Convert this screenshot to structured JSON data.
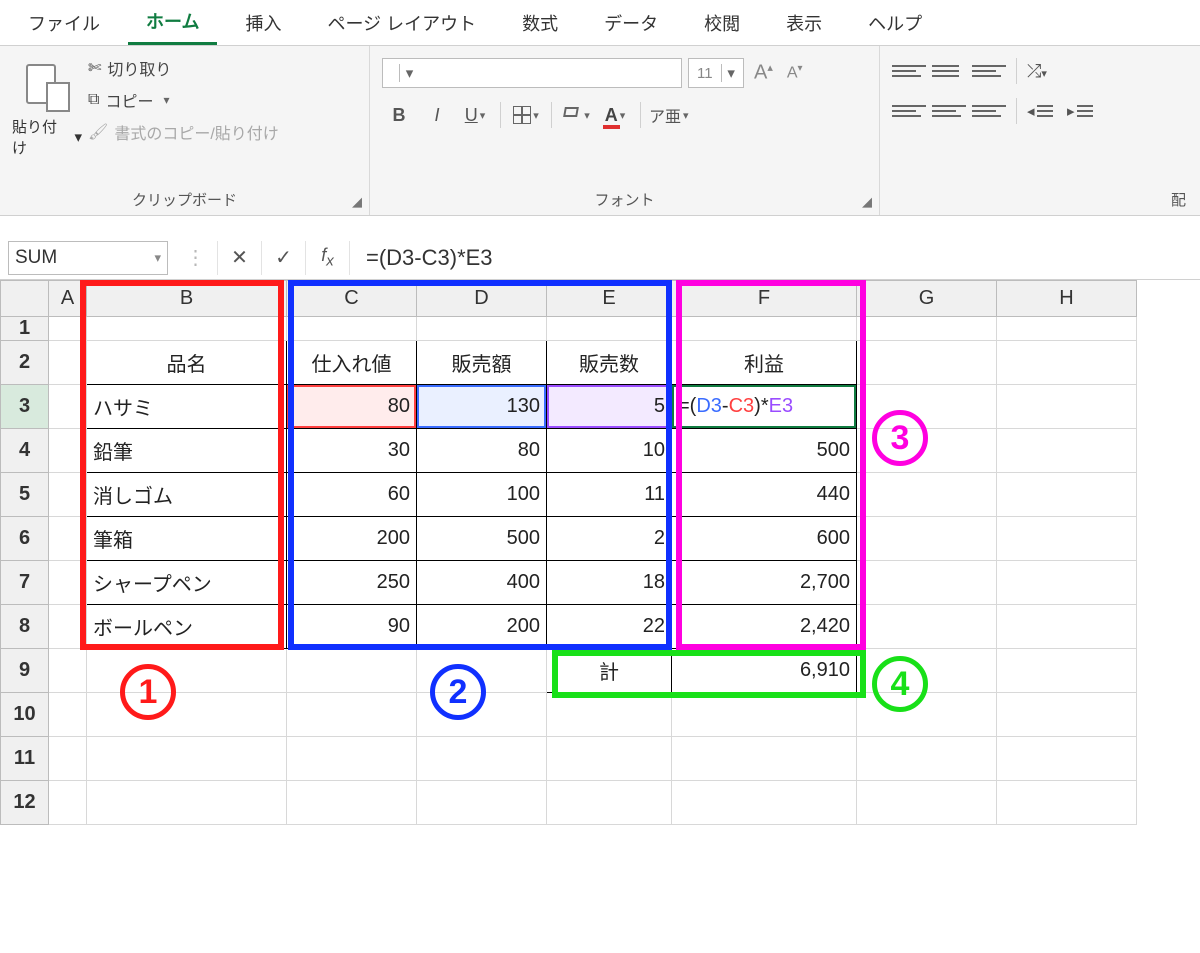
{
  "tabs": {
    "file": "ファイル",
    "home": "ホーム",
    "insert": "挿入",
    "pagelayout": "ページ レイアウト",
    "formulas": "数式",
    "data": "データ",
    "review": "校閲",
    "view": "表示",
    "help": "ヘルプ"
  },
  "ribbon": {
    "clipboard": {
      "label": "クリップボード",
      "paste": "貼り付け",
      "cut": "切り取り",
      "copy": "コピー",
      "format_painter": "書式のコピー/貼り付け"
    },
    "font": {
      "label": "フォント",
      "name": "",
      "size": "11",
      "bold": "B",
      "italic": "I",
      "underline": "U",
      "fontcolor": "A",
      "ruby": "ア亜"
    },
    "alignment": {
      "label": "配"
    }
  },
  "namebox": "SUM",
  "formula": "=(D3-C3)*E3",
  "formula_parts": {
    "d3": "D3",
    "c3": "C3",
    "e3": "E3"
  },
  "columns": [
    "A",
    "B",
    "C",
    "D",
    "E",
    "F",
    "G",
    "H"
  ],
  "row_numbers": [
    "1",
    "2",
    "3",
    "4",
    "5",
    "6",
    "7",
    "8",
    "9",
    "10",
    "11",
    "12"
  ],
  "headers": {
    "b": "品名",
    "c": "仕入れ値",
    "d": "販売額",
    "e": "販売数",
    "f": "利益"
  },
  "rows": [
    {
      "b": "ハサミ",
      "c": "80",
      "d": "130",
      "e": "5",
      "f_formula": "=(D3-C3)*E3"
    },
    {
      "b": "鉛筆",
      "c": "30",
      "d": "80",
      "e": "10",
      "f": "500"
    },
    {
      "b": "消しゴム",
      "c": "60",
      "d": "100",
      "e": "11",
      "f": "440"
    },
    {
      "b": "筆箱",
      "c": "200",
      "d": "500",
      "e": "2",
      "f": "600"
    },
    {
      "b": "シャープペン",
      "c": "250",
      "d": "400",
      "e": "18",
      "f": "2,700"
    },
    {
      "b": "ボールペン",
      "c": "90",
      "d": "200",
      "e": "22",
      "f": "2,420"
    }
  ],
  "total": {
    "label": "計",
    "value": "6,910"
  },
  "annotations": {
    "n1": "1",
    "n2": "2",
    "n3": "3",
    "n4": "4",
    "colors": {
      "red": "#ff1a1a",
      "blue": "#1030ff",
      "pink": "#ff00e0",
      "green": "#18e018"
    }
  }
}
